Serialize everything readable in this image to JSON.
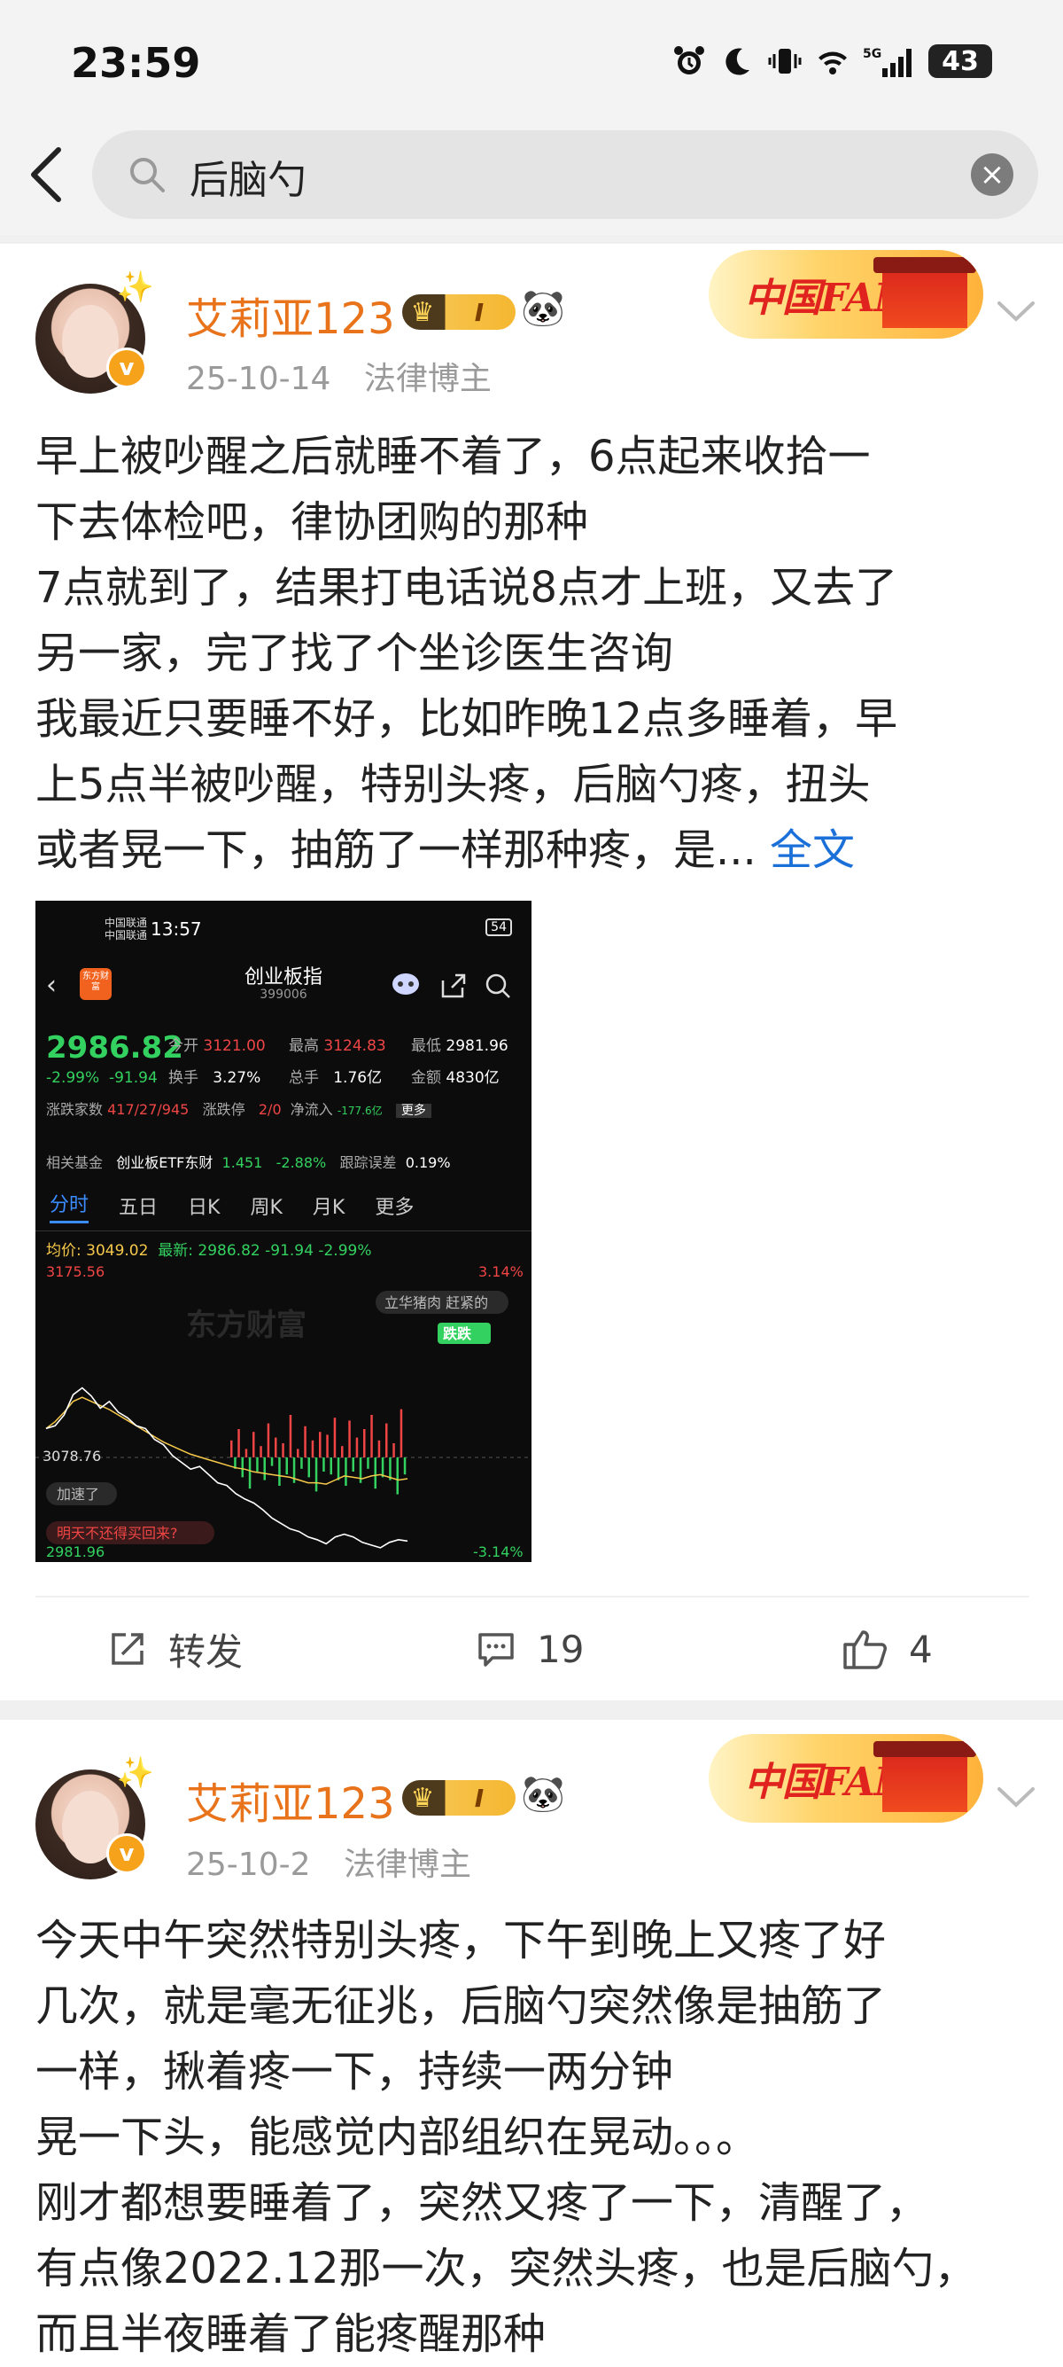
{
  "status_bar": {
    "time": "23:59",
    "network": "5G",
    "battery": "43",
    "icons": [
      "alarm-icon",
      "moon-icon",
      "vibrate-icon",
      "wifi-icon",
      "signal-icon"
    ]
  },
  "search": {
    "query": "后脑勺",
    "back_icon": "back-icon",
    "search_icon": "search-icon",
    "clear_icon": "clear-icon"
  },
  "posts": [
    {
      "username": "艾莉亚123",
      "vip_level": "I",
      "date": "25-10-14",
      "tag": "法律博主",
      "fans_banner": "中国FANS",
      "text_lines": [
        "早上被吵醒之后就睡不着了，6点起来收拾一",
        "下去体检吧，律协团购的那种",
        "7点就到了，结果打电话说8点才上班，又去了",
        "另一家，完了找了个坐诊医生咨询",
        "我最近只要睡不好，比如昨晚12点多睡着，早",
        "上5点半被吵醒，特别头疼，后脑勺疼，扭头",
        "或者晃一下，抽筋了一样那种疼，是... "
      ],
      "full_text_link": "全文",
      "actions": {
        "repost_label": "转发",
        "comments": "19",
        "likes": "4"
      }
    },
    {
      "username": "艾莉亚123",
      "vip_level": "I",
      "date": "25-10-2",
      "tag": "法律博主",
      "fans_banner": "中国FANS",
      "text_lines": [
        "今天中午突然特别头疼，下午到晚上又疼了好",
        "几次，就是毫无征兆，后脑勺突然像是抽筋了",
        "一样，揪着疼一下，持续一两分钟",
        "晃一下头，能感觉内部组织在晃动。。。",
        "刚才都想要睡着了，突然又疼了一下，清醒了，",
        "有点像2022.12那一次，突然头疼，也是后脑勺，",
        "而且半夜睡着了能疼醒那种"
      ]
    }
  ],
  "stock_image": {
    "carrier_1": "中国联通",
    "carrier_2": "中国联通",
    "time": "13:57",
    "battery": "54",
    "logo_text": "东方财富",
    "title": "创业板指",
    "code": "399006",
    "price": "2986.82",
    "change_pct": "-2.99%",
    "change_abs": "-91.94",
    "open_label": "今开",
    "open": "3121.00",
    "high_label": "最高",
    "high": "3124.83",
    "low_label": "最低",
    "low": "2981.96",
    "turnover_label": "换手",
    "turnover": "3.27%",
    "volume_label": "总手",
    "volume": "1.76亿",
    "amount_label": "金额",
    "amount": "4830亿",
    "updown_label": "涨跌家数",
    "updown": "417/27/945",
    "limit_label": "涨跌停",
    "limit": "2/0",
    "inflow_label": "净流入",
    "inflow": "-177.6亿",
    "more": "更多",
    "fund_label": "相关基金",
    "fund_name": "创业板ETF东财",
    "fund_price": "1.451",
    "fund_change": "-2.88%",
    "tracking_label": "跟踪误差",
    "tracking": "0.19%",
    "tabs": [
      "分时",
      "五日",
      "日K",
      "周K",
      "月K",
      "更多"
    ],
    "avg_label": "均价:",
    "avg": "3049.02",
    "latest_label": "最新:",
    "latest": "2986.82",
    "latest_abs": "-91.94",
    "latest_pct": "-2.99%",
    "top_price": "3175.56",
    "top_pct": "3.14%",
    "mid_price": "3078.76",
    "bottom_price": "2981.96",
    "bottom_pct": "-3.14%",
    "comment_1": "立华猪肉 赶紧的",
    "comment_2": "跌跌",
    "comment_3": "加速了",
    "comment_4": "明天不还得买回来?",
    "watermark": "东方财富",
    "price_line": [
      3070,
      3072,
      3080,
      3095,
      3100,
      3094,
      3085,
      3090,
      3082,
      3078,
      3072,
      3070,
      3062,
      3058,
      3050,
      3045,
      3040,
      3042,
      3036,
      3030,
      3028,
      3022,
      3018,
      3015,
      3010,
      3004,
      3000,
      2996,
      2994,
      2990,
      2988,
      2985,
      2990,
      2992,
      2990,
      2986,
      2984,
      2982,
      2986,
      2988,
      2987
    ],
    "avg_line": [
      3070,
      3075,
      3082,
      3090,
      3093,
      3090,
      3087,
      3084,
      3080,
      3076,
      3072,
      3068,
      3064,
      3060,
      3057,
      3054,
      3051,
      3049,
      3047,
      3045,
      3043,
      3041,
      3040,
      3038,
      3037,
      3036,
      3035,
      3034,
      3032,
      3030,
      3030,
      3029,
      3032,
      3035,
      3034,
      3033,
      3035,
      3036,
      3034,
      3032,
      3033
    ],
    "volume_bars": [
      12,
      -8,
      20,
      -14,
      6,
      -22,
      18,
      -10,
      8,
      -16,
      24,
      -6,
      14,
      -20,
      10,
      -12,
      30,
      -18,
      6,
      -8,
      22,
      -14,
      12,
      -24,
      18,
      -10,
      16,
      -12,
      28,
      -16,
      8,
      -20,
      26,
      -10,
      14,
      -18,
      20,
      -8,
      30,
      -22,
      12,
      -14,
      24,
      -16,
      10,
      -26,
      34,
      -12
    ]
  }
}
